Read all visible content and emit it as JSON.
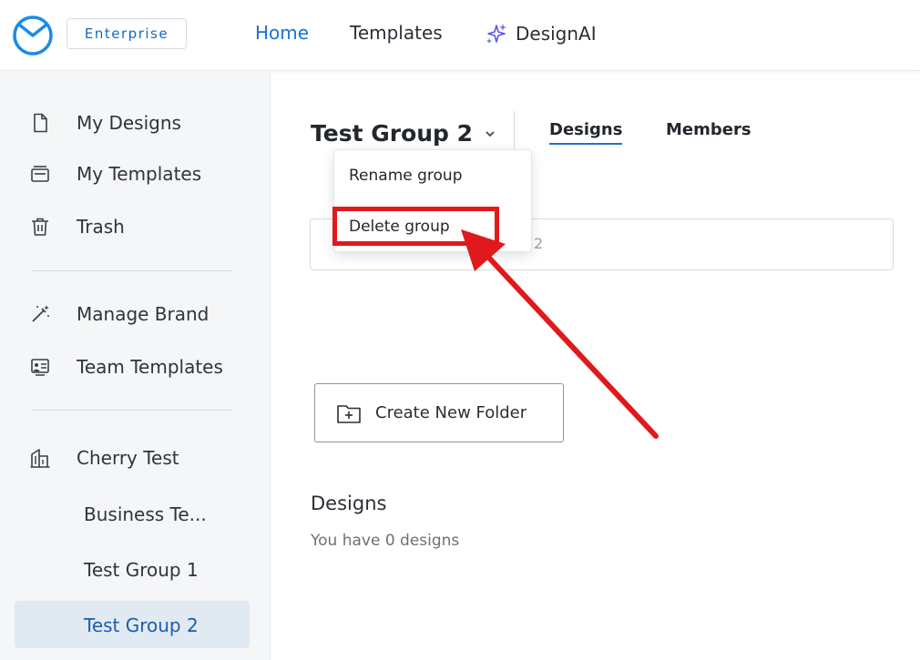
{
  "header": {
    "badge": "Enterprise",
    "nav": [
      {
        "label": "Home",
        "active": true
      },
      {
        "label": "Templates",
        "active": false
      },
      {
        "label": "DesignAI",
        "icon": "sparkle-icon"
      }
    ]
  },
  "sidebar": {
    "items": [
      {
        "label": "My Designs",
        "icon": "document-icon"
      },
      {
        "label": "My Templates",
        "icon": "templates-icon"
      },
      {
        "label": "Trash",
        "icon": "trash-icon"
      },
      {
        "label": "Manage Brand",
        "icon": "magic-wand-icon"
      },
      {
        "label": "Team Templates",
        "icon": "team-templates-icon"
      },
      {
        "label": "Cherry Test",
        "icon": "building-icon"
      }
    ],
    "groups": [
      {
        "label": "Business Te...",
        "active": false
      },
      {
        "label": "Test Group 1",
        "active": false
      },
      {
        "label": "Test Group 2",
        "active": true
      }
    ]
  },
  "main": {
    "group_title": "Test Group 2",
    "tabs": [
      {
        "label": "Designs",
        "active": true
      },
      {
        "label": "Members",
        "active": false
      }
    ],
    "search_partial": "2",
    "dropdown": {
      "rename": "Rename group",
      "delete": "Delete group"
    },
    "create_folder": "Create New Folder",
    "designs_heading": "Designs",
    "designs_count": "You have 0 designs"
  },
  "colors": {
    "accent": "#1c72d0",
    "highlight": "#e0191d",
    "sidebar_bg": "#f5f6f7",
    "active_bg": "#e1e9f2"
  }
}
